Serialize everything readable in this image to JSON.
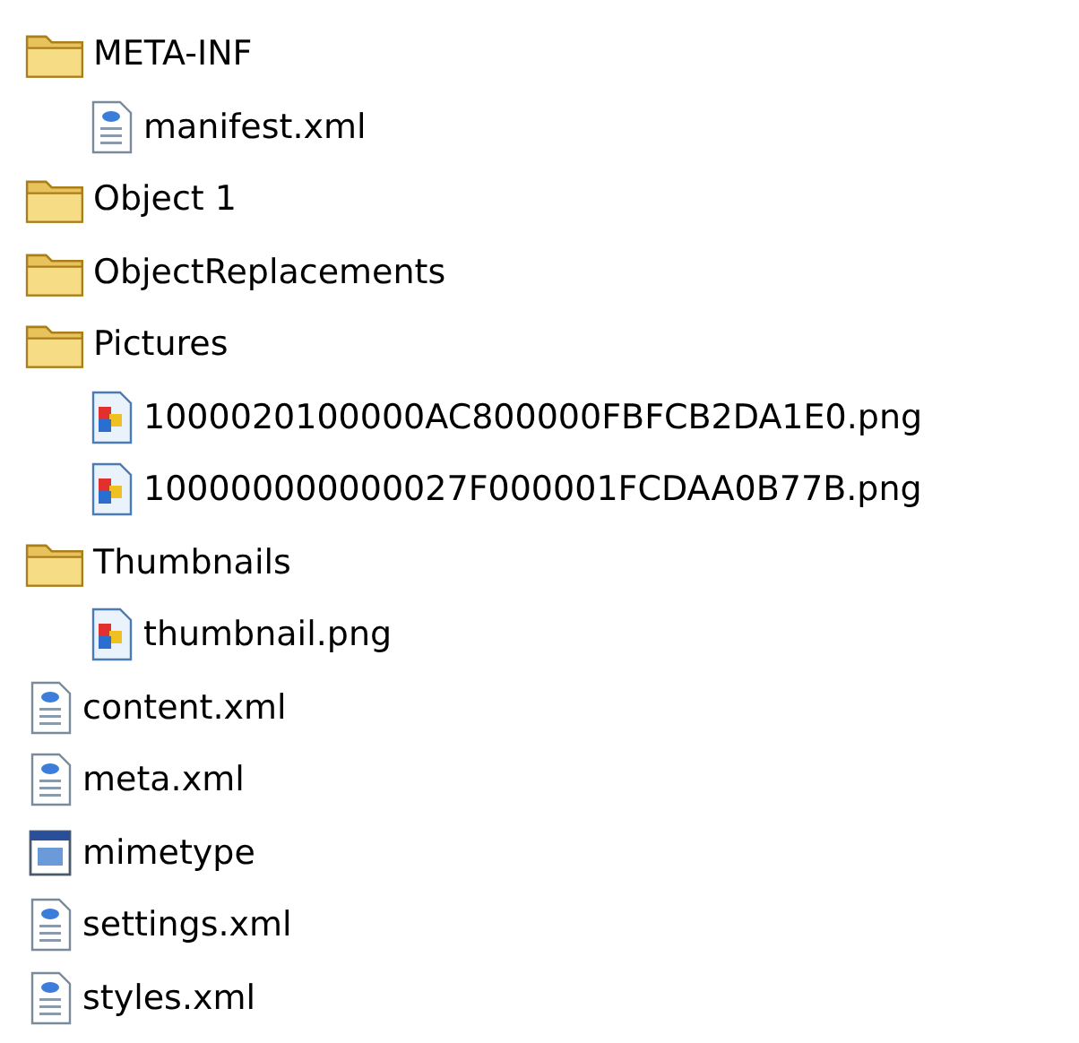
{
  "tree": [
    {
      "kind": "folder",
      "name": "META-INF",
      "children": [
        {
          "kind": "xml",
          "name": "manifest.xml"
        }
      ]
    },
    {
      "kind": "folder",
      "name": "Object 1"
    },
    {
      "kind": "folder",
      "name": "ObjectReplacements"
    },
    {
      "kind": "folder",
      "name": "Pictures",
      "children": [
        {
          "kind": "png",
          "name": "1000020100000AC800000FBFCB2DA1E0.png"
        },
        {
          "kind": "png",
          "name": "100000000000027F000001FCDAA0B77B.png"
        }
      ]
    },
    {
      "kind": "folder",
      "name": "Thumbnails",
      "children": [
        {
          "kind": "png",
          "name": "thumbnail.png"
        }
      ]
    },
    {
      "kind": "xml",
      "name": "content.xml"
    },
    {
      "kind": "xml",
      "name": "meta.xml"
    },
    {
      "kind": "app",
      "name": "mimetype"
    },
    {
      "kind": "xml",
      "name": "settings.xml"
    },
    {
      "kind": "xml",
      "name": "styles.xml"
    }
  ]
}
